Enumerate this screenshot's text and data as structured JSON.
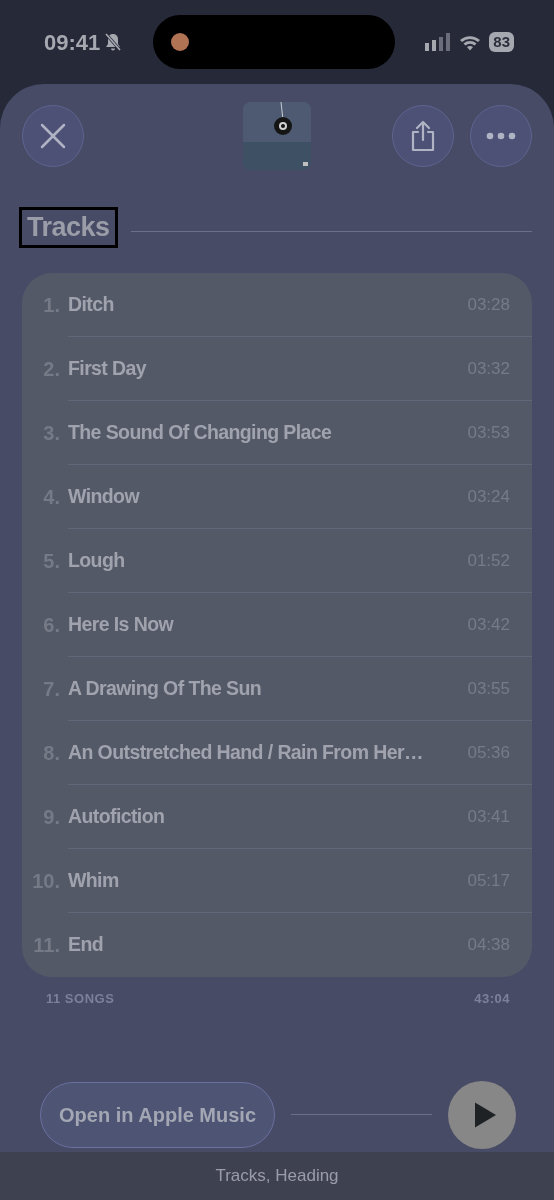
{
  "status_bar": {
    "time": "09:41",
    "battery": "83"
  },
  "header": {
    "buttons": [
      {
        "kind": "close"
      },
      {
        "kind": "share"
      },
      {
        "kind": "more"
      }
    ]
  },
  "section": {
    "title": "Tracks",
    "focused": true
  },
  "tracks": [
    {
      "number": "1.",
      "title": "Ditch",
      "duration": "03:28"
    },
    {
      "number": "2.",
      "title": "First Day",
      "duration": "03:32"
    },
    {
      "number": "3.",
      "title": "The Sound Of Changing Place",
      "duration": "03:53"
    },
    {
      "number": "4.",
      "title": "Window",
      "duration": "03:24"
    },
    {
      "number": "5.",
      "title": "Lough",
      "duration": "01:52"
    },
    {
      "number": "6.",
      "title": "Here Is Now",
      "duration": "03:42"
    },
    {
      "number": "7.",
      "title": "A Drawing Of The Sun",
      "duration": "03:55"
    },
    {
      "number": "8.",
      "title": "An Outstretched Hand / Rain From Her…",
      "duration": "05:36"
    },
    {
      "number": "9.",
      "title": "Autofiction",
      "duration": "03:41"
    },
    {
      "number": "10.",
      "title": "Whim",
      "duration": "05:17"
    },
    {
      "number": "11.",
      "title": "End",
      "duration": "04:38"
    }
  ],
  "summary": {
    "count": "11 SONGS",
    "total": "43:04"
  },
  "open_button": "Open in Apple Music",
  "caption": "Tracks, Heading"
}
